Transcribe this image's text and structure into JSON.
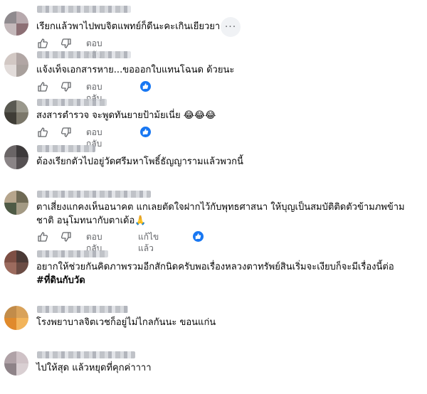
{
  "ui": {
    "reply_label": "ตอบกลับ",
    "more_label": "···",
    "like_icon": "thumbs-up-icon",
    "dislike_icon": "thumbs-down-icon",
    "reaction_icon": "like-reaction-icon",
    "accent": "#1877f2"
  },
  "comments": [
    {
      "text": "เรียกแล้วพาไปพบจิตแพทย์ก็ดีนะคะเกินเยียวยา"
    },
    {
      "text": "แจ้งเท็จเอกสารหาย...ขอออกใบแทนโฉนด ด้วยนะ"
    },
    {
      "text": "สงสารตำรวจ จะพูดทันยายป้าม้ยเนี่ย 😂😂😂"
    },
    {
      "text": "ต้องเรียกตัวไปอยู่วัดศรีมหาโพธิ์ธัญญารามแล้วพวกนี้"
    },
    {
      "line1": "ตาเสี่ยงแกคงเห็นอนาคต แกเลยตัดใจฝากไว้กับพุทธศาสนา ให้บุญเป็นสมบัติติดตัวข้ามภพข้าม",
      "line2": "ชาติ อนุโมทนากับตาเด้อ🙏",
      "edited_label": "แก้ไขแล้ว"
    },
    {
      "line1": "อยากให้ช่วยกันคิดภาพรวมอีกสักนิดครับพอเรื่องหลวงตาทรัพย์สินเริ่มจะเงียบก็จะมีเรื่องนี้ต่อ",
      "hashtag": "#ที่ดินกับวัด"
    },
    {
      "text": "โรงพยาบาลจิตเวชก็อยู่ไม่ไกลกันนะ ขอนแก่น"
    },
    {
      "text": "ไปให้สุด แล้วหยุดที่คุกค่าาาา"
    }
  ]
}
